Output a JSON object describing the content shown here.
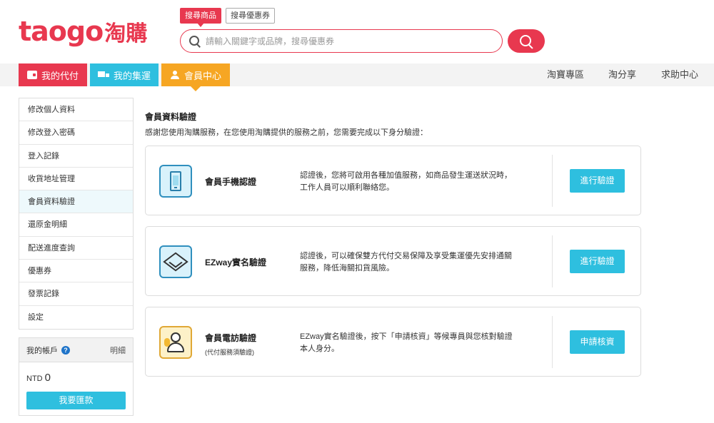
{
  "brand": {
    "logo_latin": "taogo",
    "logo_cjk": "淘購",
    "accent": "#e8384f"
  },
  "search": {
    "tabs": [
      "搜尋商品",
      "搜尋優惠券"
    ],
    "placeholder": "請輸入關鍵字或品牌，搜尋優惠券",
    "value": ""
  },
  "nav": {
    "tabs": [
      {
        "label": "我的代付",
        "icon": "wallet-icon",
        "color": "#e8384f"
      },
      {
        "label": "我的集運",
        "icon": "truck-icon",
        "color": "#2ebfdf"
      },
      {
        "label": "會員中心",
        "icon": "person-icon",
        "color": "#f6a623"
      }
    ],
    "links": [
      "淘寶專區",
      "淘分享",
      "求助中心"
    ]
  },
  "sidebar": {
    "items": [
      {
        "label": "修改個人資料"
      },
      {
        "label": "修改登入密碼"
      },
      {
        "label": "登入記錄"
      },
      {
        "label": "收貨地址管理"
      },
      {
        "label": "會員資料驗證",
        "active": true
      },
      {
        "label": "還原金明細"
      },
      {
        "label": "配送進度查詢"
      },
      {
        "label": "優惠券"
      },
      {
        "label": "發票記錄"
      },
      {
        "label": "設定"
      }
    ]
  },
  "account": {
    "title": "我的帳戶",
    "help": "?",
    "detail": "明細",
    "currency": "NTD",
    "balance": "0",
    "button": "我要匯款"
  },
  "main": {
    "title": "會員資料驗證",
    "subtitle": "感謝您使用淘購服務，在您使用淘購提供的服務之前，您需要完成以下身分驗證：",
    "cards": [
      {
        "icon": "mobile-phone-icon",
        "title": "會員手機認證",
        "subtitle": "",
        "desc_line1": "認證後，您將可啟用各種加值服務，如商品發生運送狀況時，",
        "desc_line2": "工作人員可以順利聯絡您。",
        "button": "進行驗證"
      },
      {
        "icon": "package-box-icon",
        "title": "EZway實名驗證",
        "subtitle": "",
        "desc_line1": "認證後，可以確保雙方代付交易保障及享受集運優先安排通關",
        "desc_line2": "服務，降低海關扣貨風險。",
        "button": "進行驗證"
      },
      {
        "icon": "phone-call-person-icon",
        "title": "會員電訪驗證",
        "subtitle": "(代付服務須驗證)",
        "desc_line1": "EZway實名驗證後，按下「申請核資」等候專員與您核對驗證",
        "desc_line2": "本人身分。",
        "button": "申請核資"
      }
    ]
  }
}
